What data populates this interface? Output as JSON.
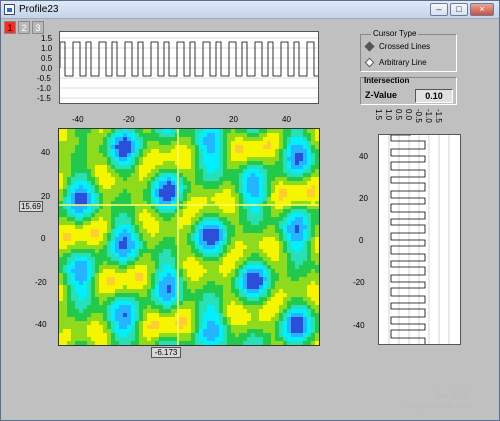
{
  "window": {
    "title": "Profile23"
  },
  "controls": {
    "minimize": "–",
    "maximize": "□",
    "close": "×"
  },
  "tabs": [
    {
      "label": "1",
      "active": true
    },
    {
      "label": "2",
      "active": false
    },
    {
      "label": "3",
      "active": false
    }
  ],
  "cursor_type": {
    "title": "Cursor Type",
    "options": [
      {
        "label": "Crossed Lines",
        "selected": true
      },
      {
        "label": "Arbitrary Line",
        "selected": false
      }
    ]
  },
  "intersection": {
    "title": "Intersection",
    "z_label": "Z-Value",
    "z_value": "0.10"
  },
  "cursor_labels": {
    "horizontal": "15.69",
    "vertical": "-6.173"
  },
  "top_plot": {
    "y_ticks": [
      "1.5",
      "1.0",
      "0.5",
      "0.0",
      "-0.5",
      "-1.0",
      "-1.5"
    ],
    "x_ticks": [
      "-40",
      "-20",
      "0",
      "20",
      "40"
    ]
  },
  "contour": {
    "y_ticks": [
      "40",
      "20",
      "0",
      "-20",
      "-40"
    ],
    "colors": [
      "#2b4fd8",
      "#25b4ff",
      "#00f0ff",
      "#28e0b8",
      "#22c94a",
      "#8ddb1c",
      "#f5f500",
      "#ffcc33",
      "#dd3333"
    ]
  },
  "right_plot": {
    "x_ticks": [
      "1.5",
      "1.0",
      "0.5",
      "0.0",
      "-0.5",
      "-1.0",
      "-1.5"
    ],
    "y_ticks": [
      "40",
      "20",
      "0",
      "-20",
      "-40"
    ]
  },
  "watermark": {
    "line1": "Bai 经验",
    "line2": "jingyan.baidu.com"
  }
}
